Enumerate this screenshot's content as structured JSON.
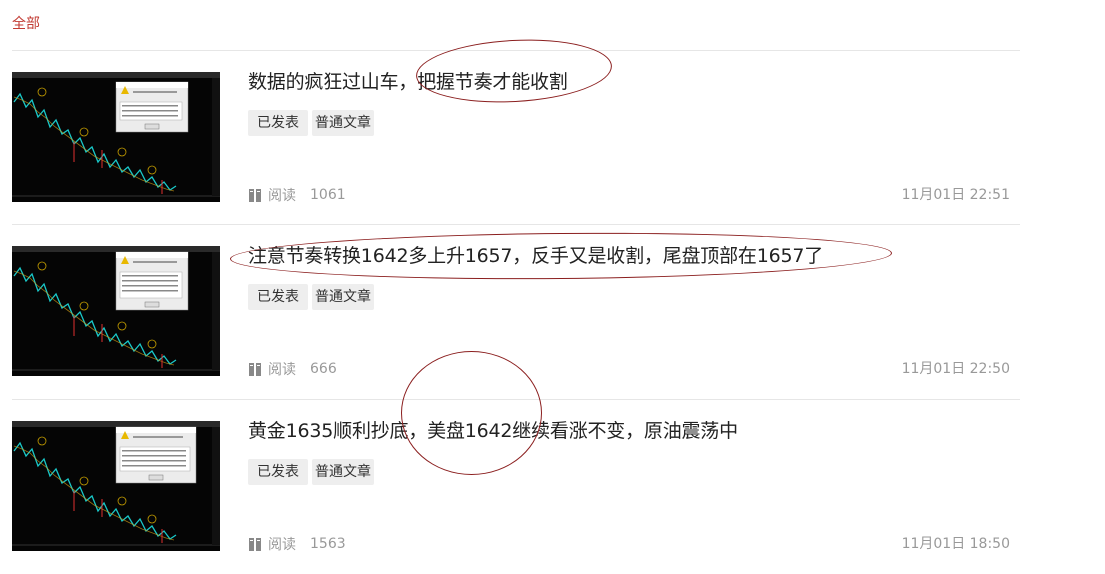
{
  "filter": {
    "all_label": "全部"
  },
  "articles": [
    {
      "title": "数据的疯狂过山车，把握节奏才能收割",
      "tags": [
        "已发表",
        "普通文章"
      ],
      "read_label": "阅读",
      "read_count": "1061",
      "date": "11月01日 22:51"
    },
    {
      "title": "注意节奏转换1642多上升1657，反手又是收割，尾盘顶部在1657了",
      "tags": [
        "已发表",
        "普通文章"
      ],
      "read_label": "阅读",
      "read_count": "666",
      "date": "11月01日 22:50"
    },
    {
      "title": "黄金1635顺利抄底，美盘1642继续看涨不变，原油震荡中",
      "tags": [
        "已发表",
        "普通文章"
      ],
      "read_label": "阅读",
      "read_count": "1563",
      "date": "11月01日 18:50"
    }
  ],
  "colors": {
    "accent": "#c23a32",
    "annotation": "#8b1f1f",
    "divider": "#e6e6e6",
    "tag_bg": "#eeeeee"
  }
}
